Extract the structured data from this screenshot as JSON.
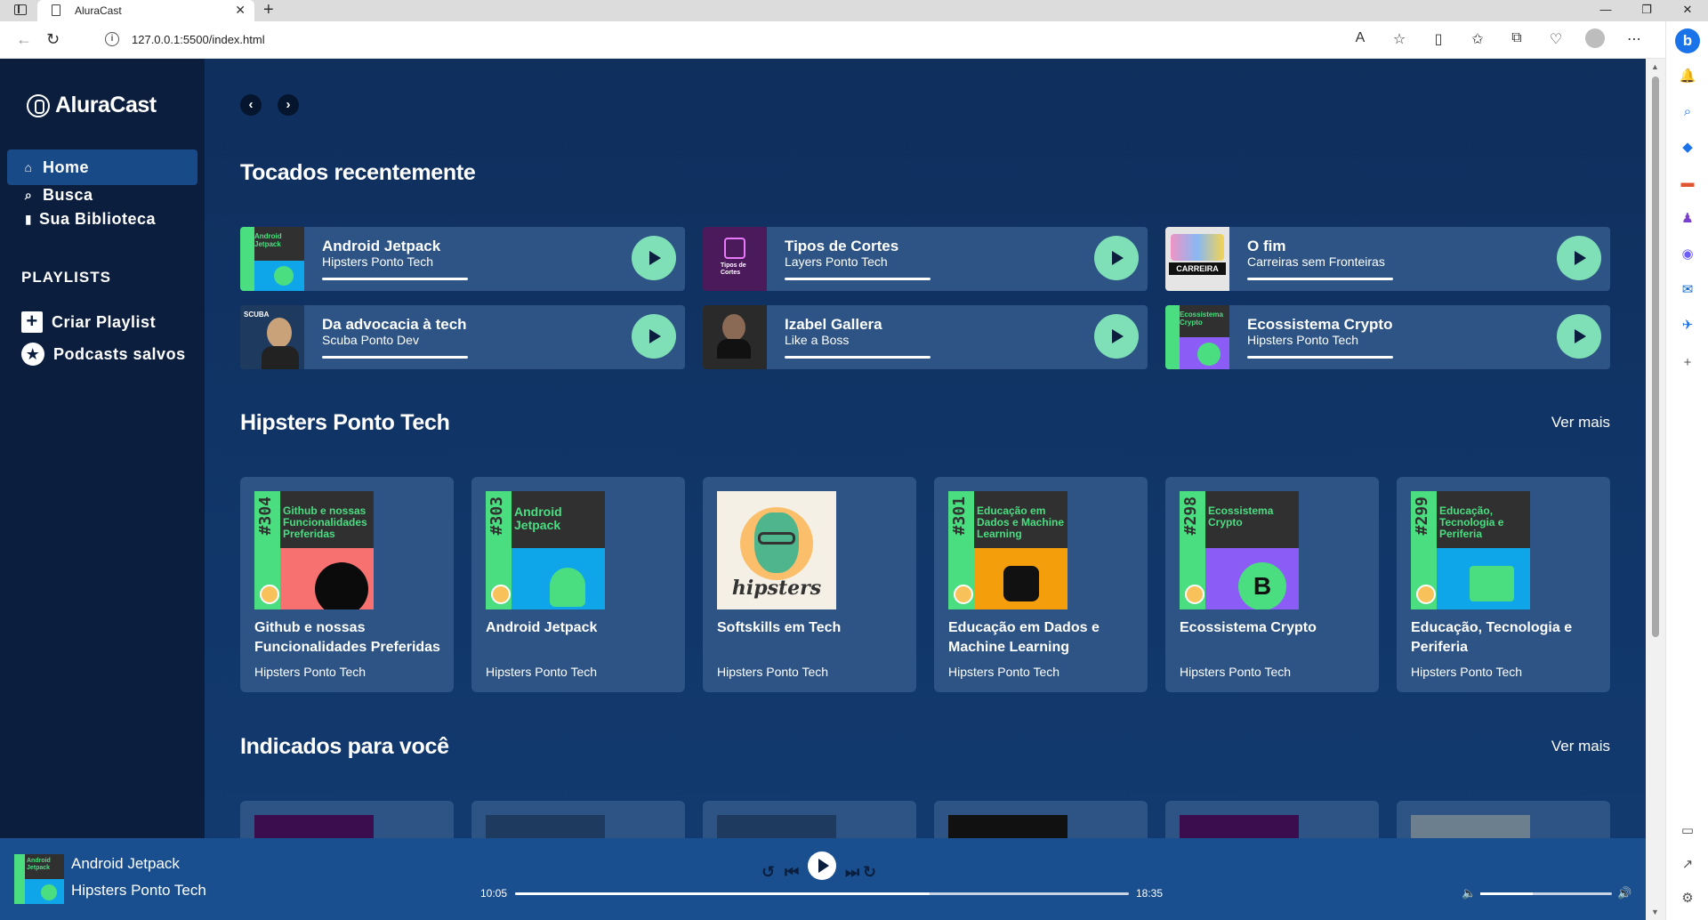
{
  "browser": {
    "tab_title": "AluraCast",
    "url": "127.0.0.1:5500/index.html"
  },
  "sidebar": {
    "logo": "AluraCast",
    "nav": [
      {
        "label": "Home",
        "icon": "home-icon"
      },
      {
        "label": "Busca",
        "icon": "search-icon"
      },
      {
        "label": "Sua Biblioteca",
        "icon": "bookmark-icon"
      }
    ],
    "playlists_title": "PLAYLISTS",
    "playlist_items": [
      {
        "label": "Criar Playlist",
        "icon": "plus-icon"
      },
      {
        "label": "Podcasts salvos",
        "icon": "star-icon"
      }
    ]
  },
  "recent": {
    "title": "Tocados recentemente",
    "items": [
      {
        "title": "Android Jetpack",
        "subtitle": "Hipsters Ponto Tech",
        "color": "#0ea5e9"
      },
      {
        "title": "Tipos de Cortes",
        "subtitle": "Layers Ponto Tech",
        "color": "#4a1a5a"
      },
      {
        "title": "O fim",
        "subtitle": "Carreiras sem Fronteiras",
        "color": "#e5e5e5"
      },
      {
        "title": "Da advocacia à tech",
        "subtitle": "Scuba Ponto Dev",
        "color": "#1e3a5f"
      },
      {
        "title": "Izabel Gallera",
        "subtitle": "Like a Boss",
        "color": "#2a2a2a"
      },
      {
        "title": "Ecossistema Crypto",
        "subtitle": "Hipsters Ponto Tech",
        "color": "#7c3aed"
      }
    ]
  },
  "hipsters": {
    "title": "Hipsters Ponto Tech",
    "more": "Ver mais",
    "items": [
      {
        "title": "Github e nossas Funcionalidades Preferidas",
        "author": "Hipsters Ponto Tech",
        "num": "#304",
        "art_text": "Github e nossas Funcionalidades Preferidas",
        "bg": "#f87171"
      },
      {
        "title": "Android Jetpack",
        "author": "Hipsters Ponto Tech",
        "num": "#303",
        "art_text": "Android Jetpack",
        "bg": "#0ea5e9"
      },
      {
        "title": "Softskills em Tech",
        "author": "Hipsters Ponto Tech",
        "num": "",
        "art_text": "",
        "bg": "#f5f0e6"
      },
      {
        "title": "Educação em Dados e Machine Learning",
        "author": "Hipsters Ponto Tech",
        "num": "#301",
        "art_text": "Educação em Dados e Machine Learning",
        "bg": "#f59e0b"
      },
      {
        "title": "Ecossistema Crypto",
        "author": "Hipsters Ponto Tech",
        "num": "#298",
        "art_text": "Ecossistema Crypto",
        "bg": "#8b5cf6"
      },
      {
        "title": "Educação, Tecnologia e Periferia",
        "author": "Hipsters Ponto Tech",
        "num": "#299",
        "art_text": "Educação, Tecnologia e Periferia",
        "bg": "#0ea5e9"
      }
    ]
  },
  "indicados": {
    "title": "Indicados para você",
    "more": "Ver mais"
  },
  "player": {
    "track": "Android Jetpack",
    "artist": "Hipsters Ponto Tech",
    "current_time": "10:05",
    "total_time": "18:35",
    "progress": 0.675,
    "volume": 0.4
  }
}
